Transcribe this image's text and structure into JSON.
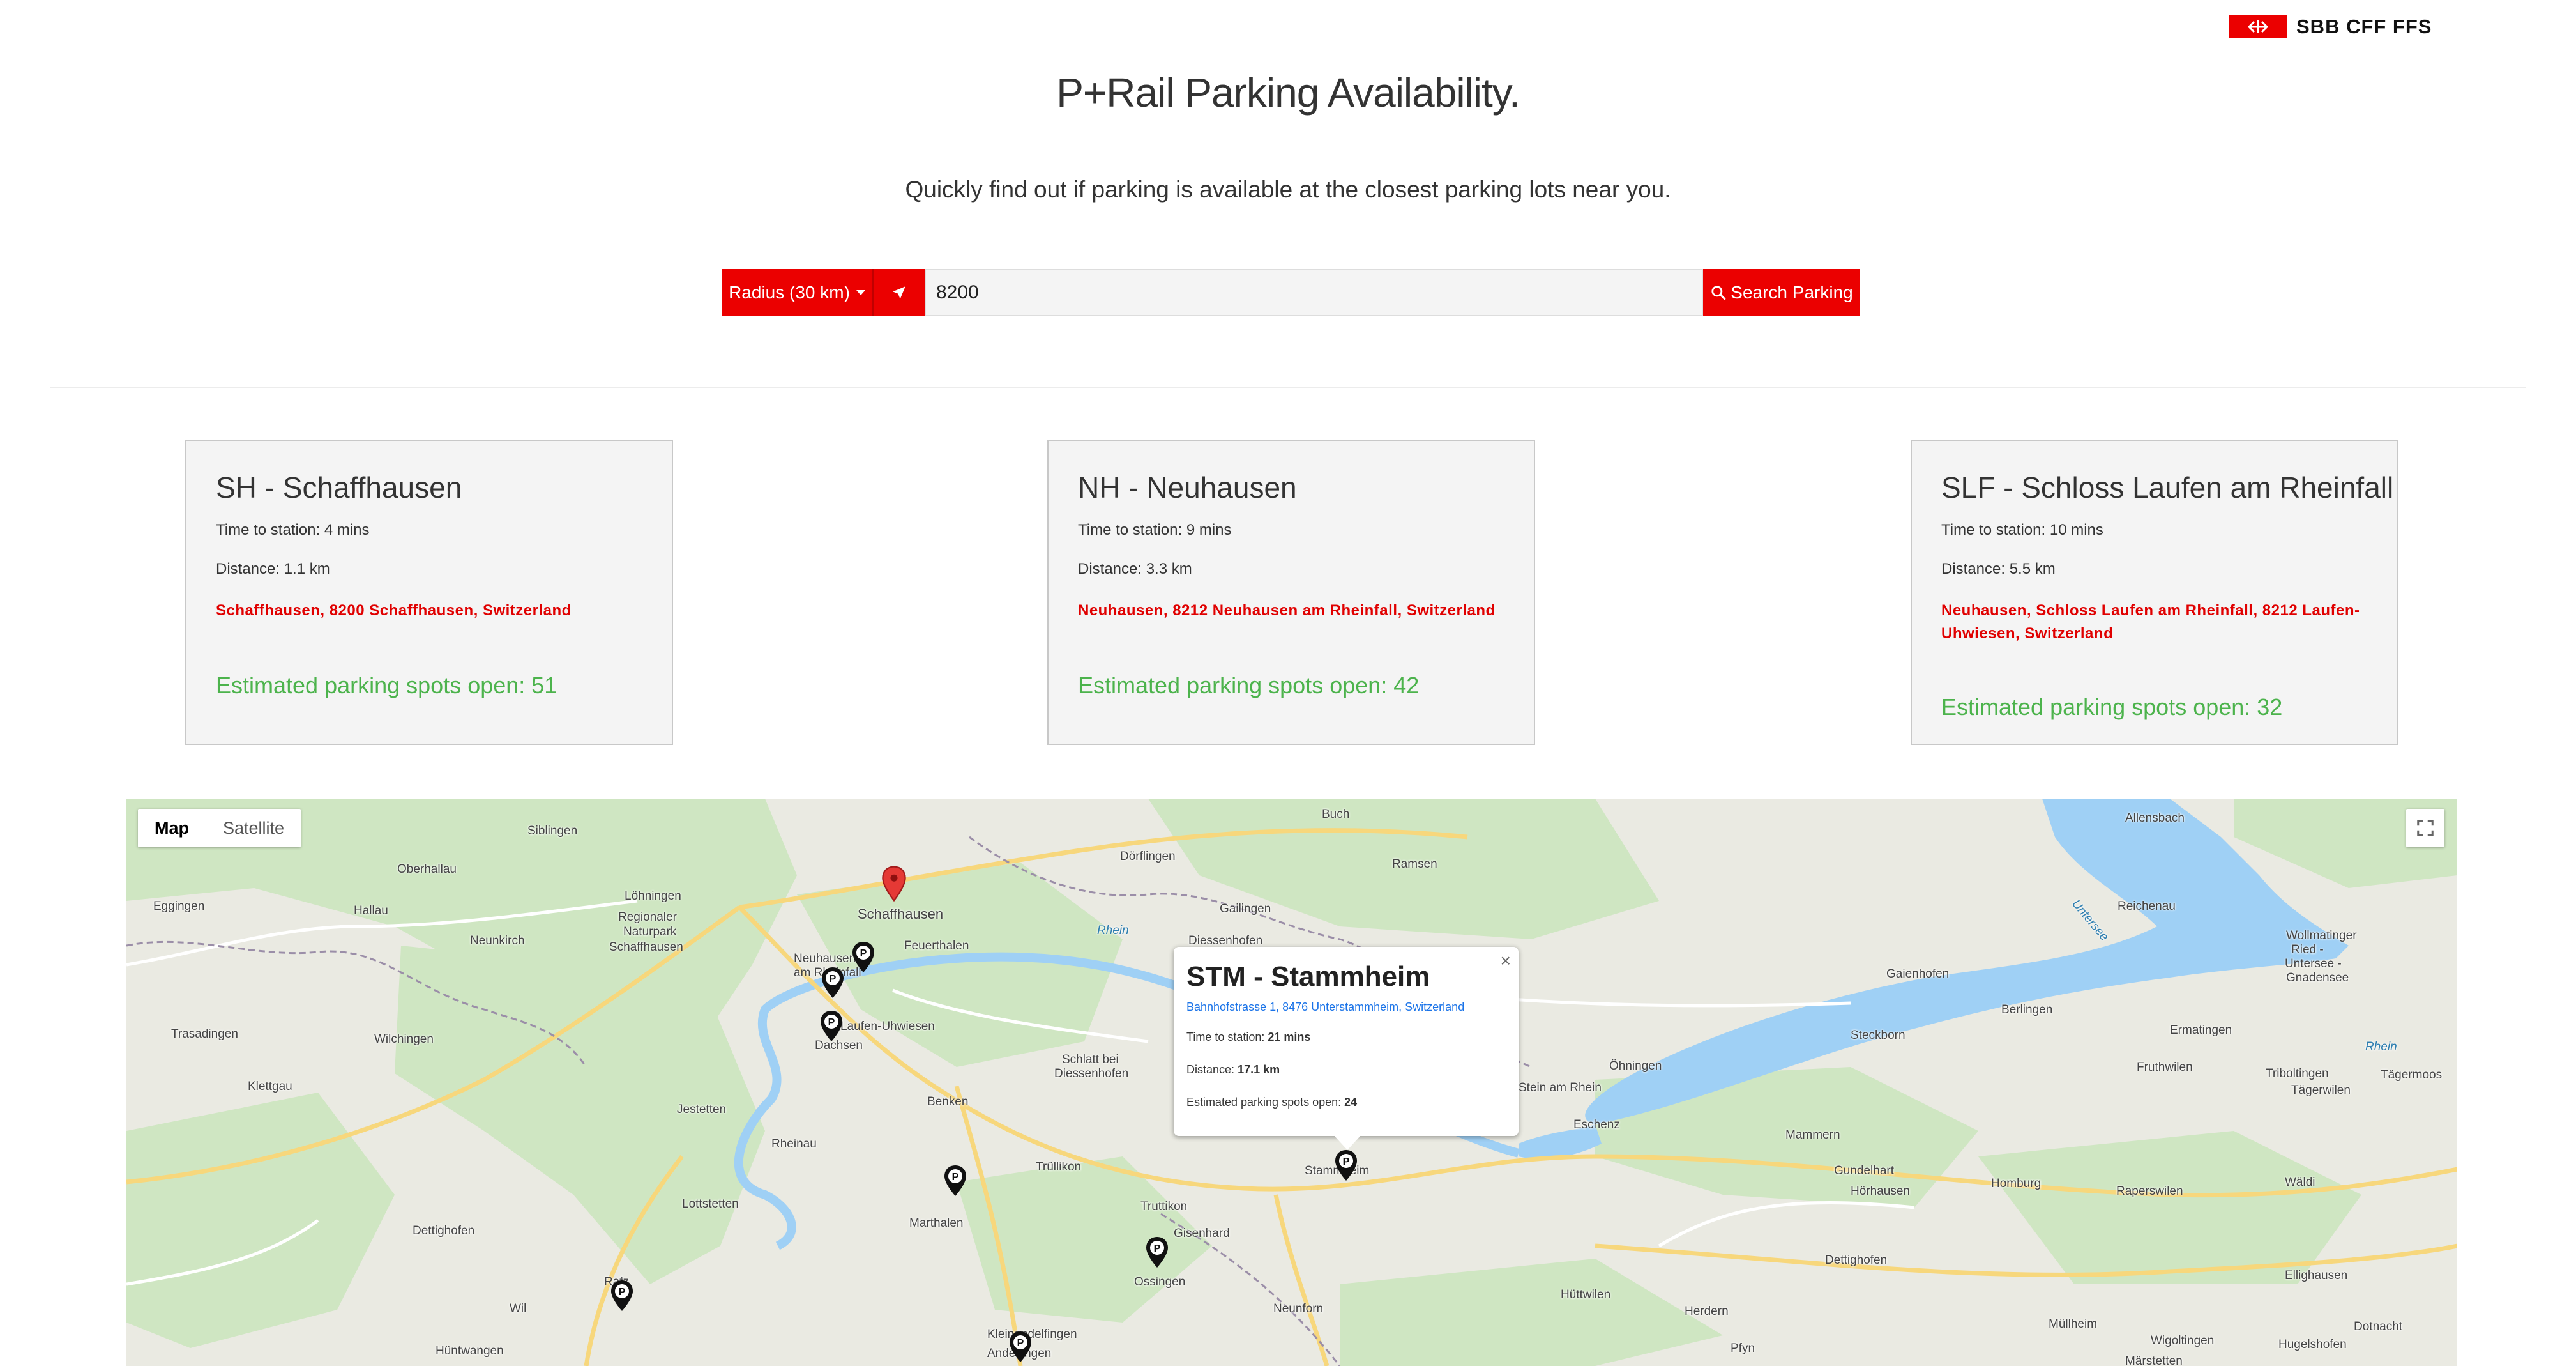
{
  "brand": {
    "logo_text": "SBB CFF FFS",
    "accent_color": "#eb0000"
  },
  "header": {
    "title": "P+Rail Parking Availability.",
    "subtitle": "Quickly find out if parking is available at the closest parking lots near you."
  },
  "search": {
    "radius_label": "Radius (30 km)",
    "query_value": "8200",
    "search_label": "Search Parking"
  },
  "results": [
    {
      "title": "SH - Schaffhausen",
      "time": "Time to station: 4 mins",
      "distance": "Distance: 1.1 km",
      "address": "Schaffhausen, 8200 Schaffhausen, Switzerland",
      "spots": "Estimated parking spots open: 51"
    },
    {
      "title": "NH - Neuhausen",
      "time": "Time to station: 9 mins",
      "distance": "Distance: 3.3 km",
      "address": "Neuhausen, 8212 Neuhausen am Rheinfall, Switzerland",
      "spots": "Estimated parking spots open: 42"
    },
    {
      "title": "SLF - Schloss Laufen am Rheinfall",
      "time": "Time to station: 10 mins",
      "distance": "Distance: 5.5 km",
      "address": "Neuhausen, Schloss Laufen am Rheinfall, 8212 Laufen-Uhwiesen, Switzerland",
      "spots": "Estimated parking spots open: 32"
    }
  ],
  "map": {
    "tab_map": "Map",
    "tab_satellite": "Satellite",
    "popup": {
      "title": "STM - Stammheim",
      "address": "Bahnhofstrasse 1, 8476 Unterstammheim, Switzerland",
      "time_label": "Time to station:",
      "time_value": "21 mins",
      "distance_label": "Distance:",
      "distance_value": "17.1 km",
      "spots_label": "Estimated parking spots open:",
      "spots_value": "24",
      "close": "×"
    },
    "places": {
      "siblingen": "Siblingen",
      "buch": "Buch",
      "allensbach": "Allensbach",
      "oberhallau": "Oberhallau",
      "lohningen": "Löhningen",
      "regionaler": "Regionaler",
      "naturpark": "Naturpark",
      "schaffhausen_np": "Schaffhausen",
      "schaffhausen": "Schaffhausen",
      "dorflingen": "Dörflingen",
      "ramsen": "Ramsen",
      "reichenau": "Reichenau",
      "eggingen": "Eggingen",
      "hallau": "Hallau",
      "neunkirch": "Neunkirch",
      "feuerthalen": "Feuerthalen",
      "gailingen": "Gailingen",
      "diessenhofen": "Diessenhofen",
      "gaienhofen": "Gaienhofen",
      "neuhausen": "Neuhausen",
      "am_rheinfall": "am Rheinfall",
      "wollmatinger": "Wollmatinger",
      "ried": "Ried -",
      "untersee_g": "Untersee -",
      "gnadensee": "Gnadensee",
      "trasadingen": "Trasadingen",
      "wilchingen": "Wilchingen",
      "laufen": "Laufen-Uhwiesen",
      "dachsen": "Dachsen",
      "berlingen": "Berlingen",
      "steckborn": "Steckborn",
      "ermatingen": "Ermatingen",
      "schlatt1": "Schlatt bei",
      "schlatt2": "Diessenhofen",
      "ohningen": "Öhningen",
      "fruthwilen": "Fruthwilen",
      "klettgau": "Klettgau",
      "triboltingen": "Triboltingen",
      "tagerwilen": "Tägerwilen",
      "stein": "Stein am Rhein",
      "tagermoos": "Tägermoos",
      "jestetten": "Jestetten",
      "benken": "Benken",
      "eschenz": "Eschenz",
      "mammern": "Mammern",
      "rheinau": "Rheinau",
      "trullikon": "Trüllikon",
      "stammheim": "Stammheim",
      "gundelhart": "Gundelhart",
      "lottstetten": "Lottstetten",
      "truttikon": "Truttikon",
      "horhausen": "Hörhausen",
      "homburg": "Homburg",
      "raperswilen": "Raperswilen",
      "waldi": "Wäldi",
      "dettighofen": "Dettighofen",
      "marthalen": "Marthalen",
      "gisenhard": "Gisenhard",
      "ossingen": "Ossingen",
      "huttwilen": "Hüttwilen",
      "dettighofen2": "Dettighofen",
      "ellighausen": "Ellighausen",
      "rafz": "Rafz",
      "wil": "Wil",
      "neunforn": "Neunforn",
      "herdern": "Herdern",
      "mullheim": "Müllheim",
      "wigoltingen": "Wigoltingen",
      "dotnacht": "Dotnacht",
      "huntwangen": "Hüntwangen",
      "kleinandelfingen": "Kleinandelfingen",
      "andelfingen": "Andelfingen",
      "pfyn": "Pfyn",
      "marstetten": "Märstetten",
      "hugelshofen": "Hugelshofen",
      "untersee": "Untersee",
      "rhein1": "Rhein",
      "rhein2": "Rhein"
    }
  }
}
